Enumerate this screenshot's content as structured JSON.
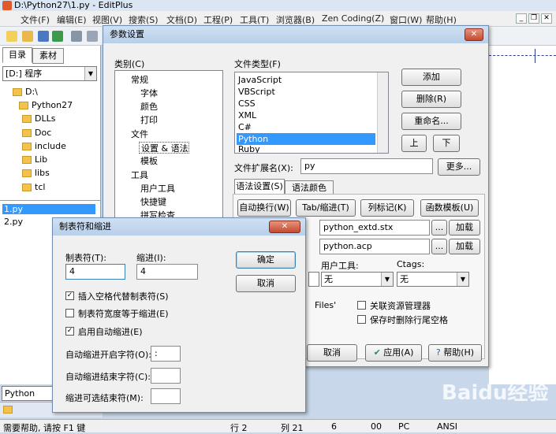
{
  "window": {
    "title": "D:\\Python27\\1.py - EditPlus"
  },
  "menu": [
    "文件(F)",
    "编辑(E)",
    "视图(V)",
    "搜索(S)",
    "文档(D)",
    "工程(P)",
    "工具(T)",
    "浏览器(B)",
    "Zen Coding(Z)",
    "窗口(W)",
    "帮助(H)"
  ],
  "sidebar": {
    "tabs": [
      "目录",
      "素材"
    ],
    "drive": "[D:] 程序",
    "tree": [
      "D:\\",
      "Python27",
      "DLLs",
      "Doc",
      "include",
      "Lib",
      "libs",
      "tcl"
    ],
    "files": [
      "1.py",
      "2.py"
    ],
    "filter": "Python (*.py"
  },
  "status": {
    "help": "需要帮助, 请按 F1 键",
    "line": "行 2",
    "col": "列 21",
    "v1": "6",
    "v2": "00",
    "pc": "PC",
    "enc": "ANSI"
  },
  "watermark": "Baidu经验",
  "pref": {
    "title": "参数设置",
    "category_label": "类别(C)",
    "categories": [
      "常规",
      "字体",
      "颜色",
      "打印",
      "文件",
      "设置 & 语法",
      "模板",
      "工具",
      "用户工具",
      "快捷键",
      "拼写检查"
    ],
    "filetype_label": "文件类型(F)",
    "filetypes": [
      "JavaScript",
      "VBScript",
      "CSS",
      "XML",
      "C#",
      "Python",
      "Ruby"
    ],
    "selected_filetype": "Python",
    "btn_add": "添加",
    "btn_delete": "删除(R)",
    "btn_rename": "重命名...",
    "btn_up": "上",
    "btn_down": "下",
    "ext_label": "文件扩展名(X):",
    "ext_value": "py",
    "btn_more": "更多...",
    "tab_syntax": "语法设置(S)",
    "tab_colors": "语法颜色(O)",
    "btn_wrap": "自动换行(W)",
    "btn_tab": "Tab/缩进(T)",
    "btn_colmark": "列标记(K)",
    "btn_func": "函数模板(U)",
    "syntax_file": "python_extd.stx",
    "autocomplete_file": "python.acp",
    "btn_dots": "...",
    "btn_load": "加载",
    "user_tools_label": "用户工具:",
    "ctags_label": "Ctags:",
    "none": "无",
    "files_frag": "Files'",
    "assoc_explorer": "关联资源管理器",
    "strip_trailing": "保存时删除行尾空格",
    "btn_cancel": "取消",
    "btn_apply": "应用(A)",
    "btn_help": "帮助(H)"
  },
  "tabdlg": {
    "title": "制表符和缩进",
    "tab_label": "制表符(T):",
    "tab_value": "4",
    "indent_label": "缩进(I):",
    "indent_value": "4",
    "btn_ok": "确定",
    "btn_cancel": "取消",
    "chk_spaces": "插入空格代替制表符(S)",
    "chk_width": "制表符宽度等于缩进(E)",
    "chk_autoindent": "启用自动缩进(E)",
    "open_label": "自动缩进开启字符(O):",
    "open_value": ":",
    "close_label": "自动缩进结束字符(C):",
    "opt_label": "缩进可选结束符(M):"
  }
}
